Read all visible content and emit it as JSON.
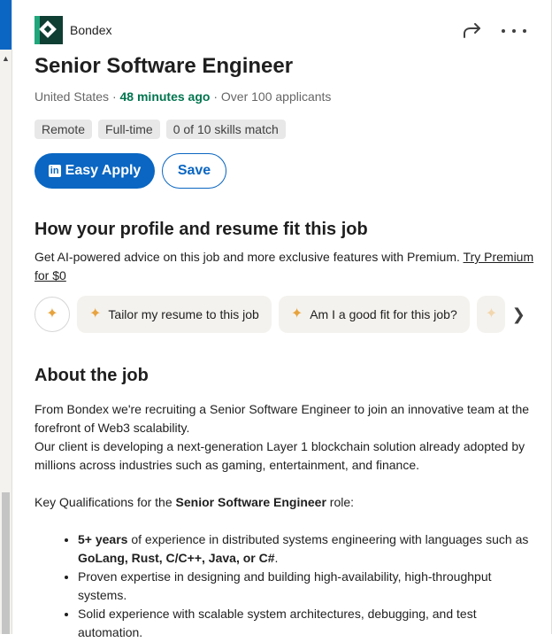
{
  "company": {
    "name": "Bondex",
    "logo": "bondex-logo"
  },
  "job": {
    "title": "Senior Software Engineer",
    "location": "United States",
    "posted": "48 minutes ago",
    "applicants": "Over 100 applicants",
    "separator": " · "
  },
  "tags": [
    "Remote",
    "Full-time",
    "0 of 10 skills match"
  ],
  "actions": {
    "easy_apply": "Easy Apply",
    "linkedin_glyph": "in",
    "save": "Save"
  },
  "fit": {
    "heading": "How your profile and resume fit this job",
    "description": "Get AI-powered advice on this job and more exclusive features with Premium. ",
    "premium_link": "Try Premium for $0",
    "chips": [
      "Tailor my resume to this job",
      "Am I a good fit for this job?"
    ]
  },
  "about": {
    "heading": "About the job",
    "p1": "From Bondex we're recruiting a Senior Software Engineer to join an innovative team at the forefront of Web3 scalability.",
    "p2": "Our client is developing a next-generation Layer 1 blockchain solution already adopted by millions across industries such as gaming, entertainment, and finance.",
    "key_prefix": "Key Qualifications for the ",
    "key_role": "Senior Software Engineer",
    "key_suffix": " role:",
    "b1_bold": "5+ years",
    "b1_mid": " of experience in distributed systems engineering with languages such as ",
    "b1_langs": "GoLang, Rust, C/C++, Java, or C#",
    "b1_end": ".",
    "b2": "Proven expertise in designing and building high-availability, high-throughput systems.",
    "b3": "Solid experience with scalable system architectures, debugging, and test automation."
  },
  "colors": {
    "brand": "#0a66c2",
    "posted_time": "#01754f",
    "sparkle": "#e7a33e"
  }
}
